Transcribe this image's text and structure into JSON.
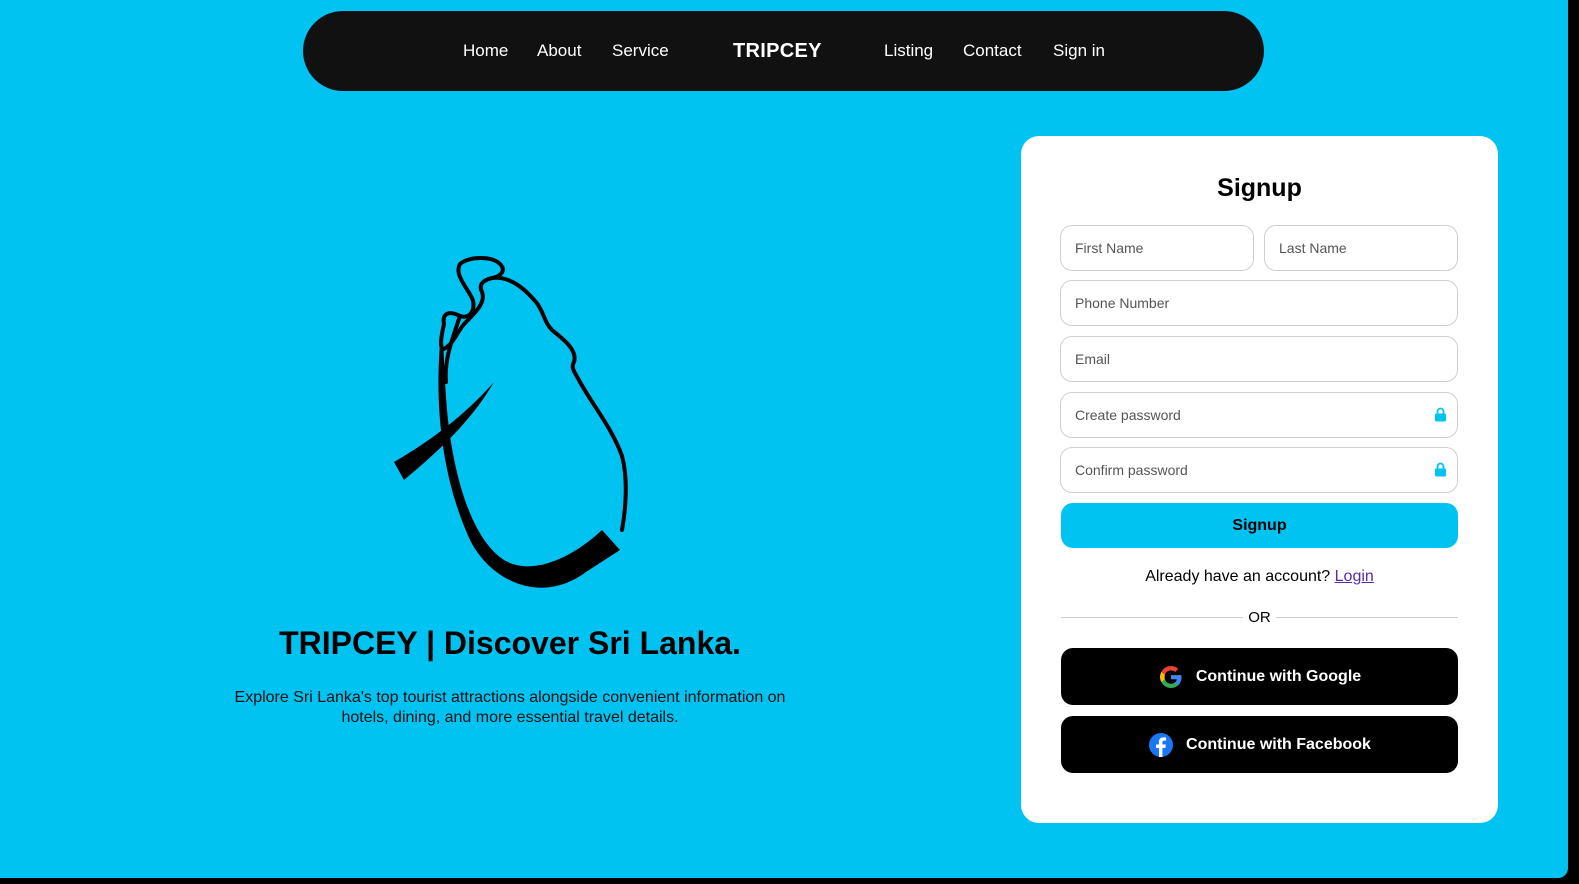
{
  "nav": {
    "links": [
      {
        "label": "Home"
      },
      {
        "label": "About"
      },
      {
        "label": "Service"
      },
      {
        "label": "Listing"
      },
      {
        "label": "Contact"
      },
      {
        "label": "Sign in"
      }
    ],
    "brand": "TRIPCEY"
  },
  "hero": {
    "logo_icon": "sri-lanka-map-icon",
    "title": "TRIPCEY | Discover Sri Lanka.",
    "description": "Explore Sri Lanka's top tourist attractions alongside convenient information on hotels, dining, and more essential travel details."
  },
  "signup": {
    "title": "Signup",
    "first_name_placeholder": "First Name",
    "last_name_placeholder": "Last Name",
    "phone_placeholder": "Phone Number",
    "email_placeholder": "Email",
    "create_password_placeholder": "Create password",
    "confirm_password_placeholder": "Confirm password",
    "password_icon": "lock-icon",
    "submit_label": "Signup",
    "already_text": "Already have an account?",
    "login_link": "Login",
    "or_text": "OR",
    "google_label": "Continue with Google",
    "facebook_label": "Continue with Facebook"
  },
  "colors": {
    "background": "#00c3f2",
    "nav_background": "#111111",
    "card_background": "#ffffff",
    "accent": "#00c3f2",
    "social_button": "#000000",
    "link": "#5a2ca0"
  }
}
